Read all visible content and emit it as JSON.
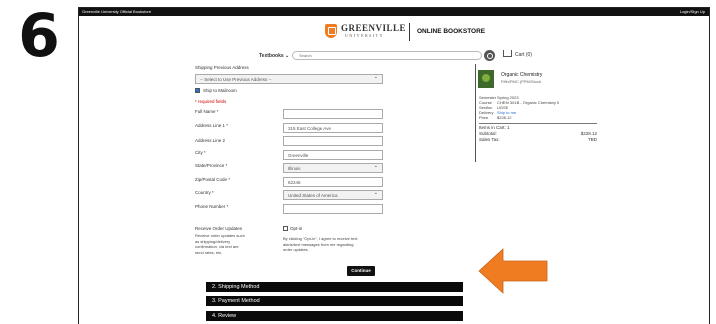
{
  "step_number": "6",
  "topbar": {
    "left_text": "Greenville University Official Bookstore",
    "right_text": "Login/Sign Up"
  },
  "logo": {
    "name": "GREENVILLE",
    "sub": "UNIVERSITY",
    "store": "ONLINE BOOKSTORE"
  },
  "nav": {
    "textbooks_label": "Textbooks ⌄",
    "search_placeholder": "Search",
    "cart_label": "Cart (0)"
  },
  "form": {
    "previous_address_label": "Shipping Previous Address",
    "previous_address_value": "-- Select to Use Previous Address --",
    "ship_mailroom_label": "Ship to Mailroom",
    "required_note": "* required fields",
    "full_name_label": "Full Name *",
    "full_name_value": "",
    "address1_label": "Address Line 1 *",
    "address1_value": "315 East College Ave",
    "address2_label": "Address Line 2",
    "address2_value": "",
    "city_label": "City *",
    "city_value": "Greenville",
    "state_label": "State/Province *",
    "state_value": "Illinois",
    "zip_label": "Zip/Postal Code *",
    "zip_value": "62246",
    "country_label": "Country *",
    "country_value": "United States of America",
    "phone_label": "Phone Number *",
    "phone_value": "",
    "updates_label": "Receive Order Updates",
    "updates_desc_1": "Receive order updates such",
    "updates_desc_2": "as shipping/delivery",
    "updates_desc_3": "confirmation, via text are",
    "updates_desc_4": "send rates, etc.",
    "optin_label": "Opt-in",
    "optin_desc_1": "By clicking \"Opt-in\", I agree to receive text",
    "optin_desc_2": "alerts/text messages from me regarding",
    "optin_desc_3": "order updates.",
    "continue_label": "Continue"
  },
  "steps": [
    {
      "label": "2. Shipping Method"
    },
    {
      "label": "3. Payment Method"
    },
    {
      "label": "4. Review"
    }
  ],
  "summary": {
    "book_title": "Organic Chemistry",
    "book_author": "Fifth/PMC (PPM/Stock",
    "rows": [
      {
        "key": "Semester",
        "value": "Spring 2023"
      },
      {
        "key": "Course",
        "value": "CHEM 301B - Organic Chemistry II"
      },
      {
        "key": "Section",
        "value": "UGSE"
      },
      {
        "key": "Delivery",
        "value": "Ship to me"
      },
      {
        "key": "Price",
        "value": "$228.12"
      }
    ],
    "items_label": "Items in Cart: 1",
    "subtotal_label": "Subtotal:",
    "subtotal_value": "$228.12",
    "tax_label": "Sales Tax:",
    "tax_value": "TBD"
  },
  "colors": {
    "accent_orange": "#f07c22",
    "checkbox_blue": "#2a6ed8",
    "dark": "#0a0a0a"
  }
}
